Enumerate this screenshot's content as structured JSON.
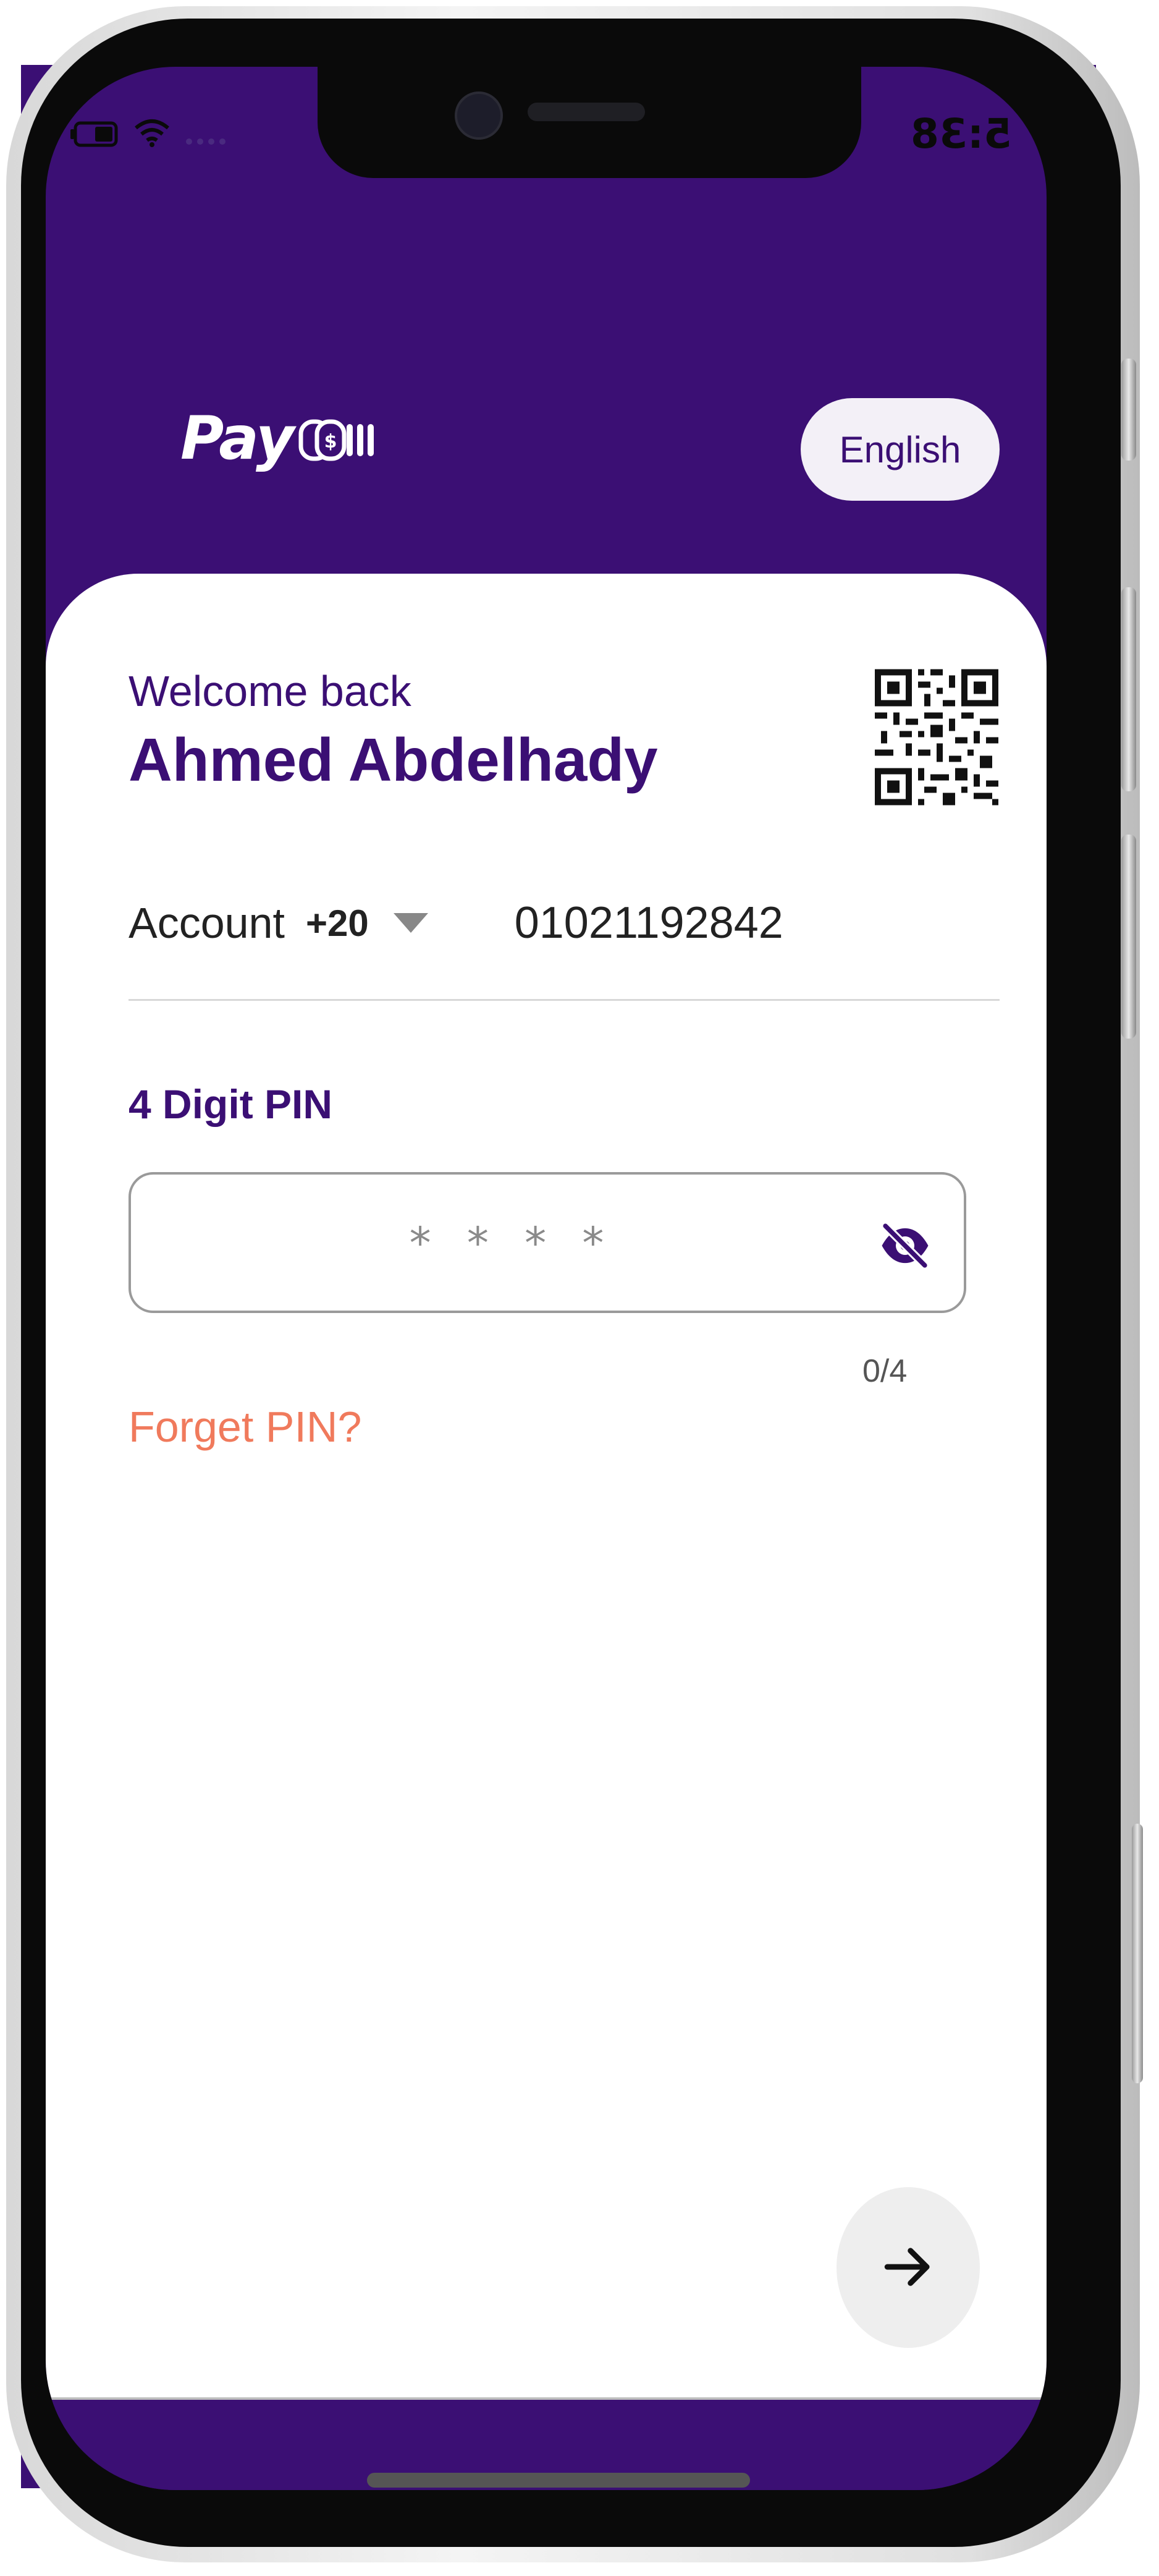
{
  "status_bar": {
    "time": "5:38"
  },
  "header": {
    "logo_text": "Pay",
    "language_button": "English"
  },
  "login_card": {
    "welcome": "Welcome back",
    "user_name": "Ahmed Abdelhady",
    "account_label": "Account",
    "country_code": "+20",
    "phone_number": "01021192842",
    "pin_label": "4 Digit PIN",
    "pin_placeholder": "* * * *",
    "pin_counter": "0/4",
    "forget_pin": "Forget PIN?"
  },
  "icons": {
    "visibility": "eye-off-icon",
    "next": "arrow-right-icon",
    "qr": "qr-code-icon",
    "dropdown": "triangle-down-icon"
  },
  "colors": {
    "brand_purple": "#3b0f74",
    "link_orange": "#f07a5c",
    "language_button_bg": "#f3f0f7",
    "next_button_bg": "#eeeeee"
  }
}
